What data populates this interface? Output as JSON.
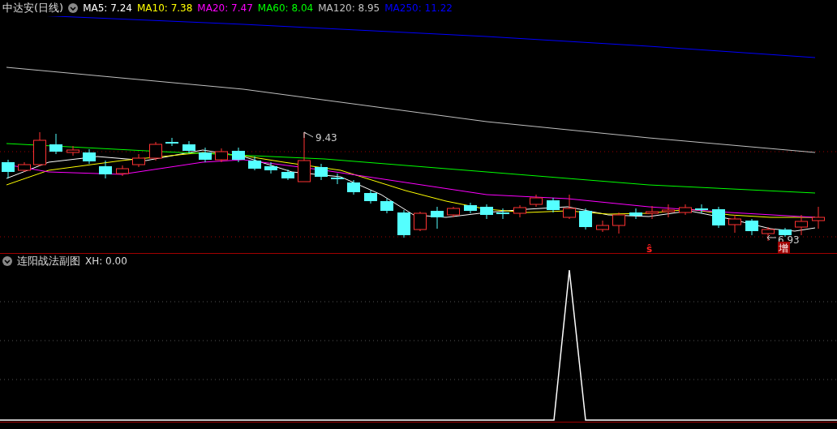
{
  "main_chart": {
    "title": "中达安(日线)",
    "indicators": [
      {
        "label": "MA5: 7.24",
        "color": "#ffffff"
      },
      {
        "label": "MA10: 7.38",
        "color": "#ffff00"
      },
      {
        "label": "MA20: 7.47",
        "color": "#ff00ff"
      },
      {
        "label": "MA60: 8.04",
        "color": "#00ff00"
      },
      {
        "label": "MA120: 8.95",
        "color": "#c0c0c0"
      },
      {
        "label": "MA250: 11.22",
        "color": "#0000ff"
      }
    ],
    "high_label": "9.43",
    "low_label": "6.93",
    "signal_mark": "ŝ",
    "signal_badge": "增"
  },
  "sub_chart": {
    "title": "连阳战法副图",
    "reading": "XH: 0.00"
  }
}
